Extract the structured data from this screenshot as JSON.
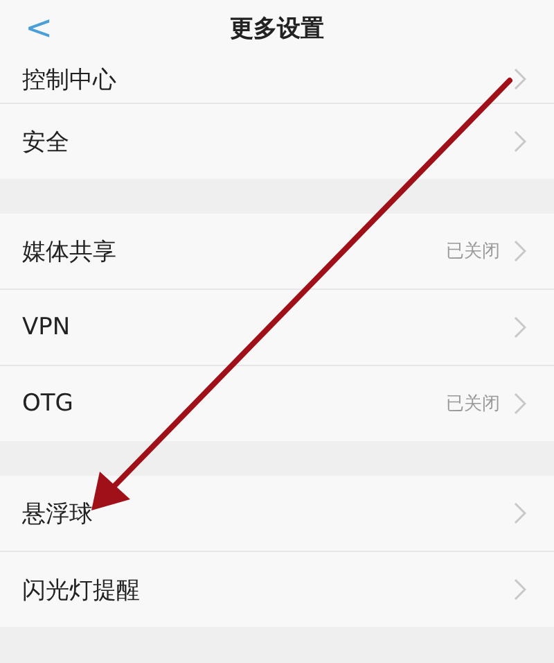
{
  "header": {
    "back": "<",
    "title": "更多设置"
  },
  "groups": [
    {
      "items": [
        {
          "label": "控制中心"
        },
        {
          "label": "安全"
        }
      ]
    },
    {
      "items": [
        {
          "label": "媒体共享",
          "status": "已关闭"
        },
        {
          "label": "VPN"
        },
        {
          "label": "OTG",
          "status": "已关闭"
        }
      ]
    },
    {
      "items": [
        {
          "label": "悬浮球"
        },
        {
          "label": "闪光灯提醒"
        }
      ]
    }
  ]
}
